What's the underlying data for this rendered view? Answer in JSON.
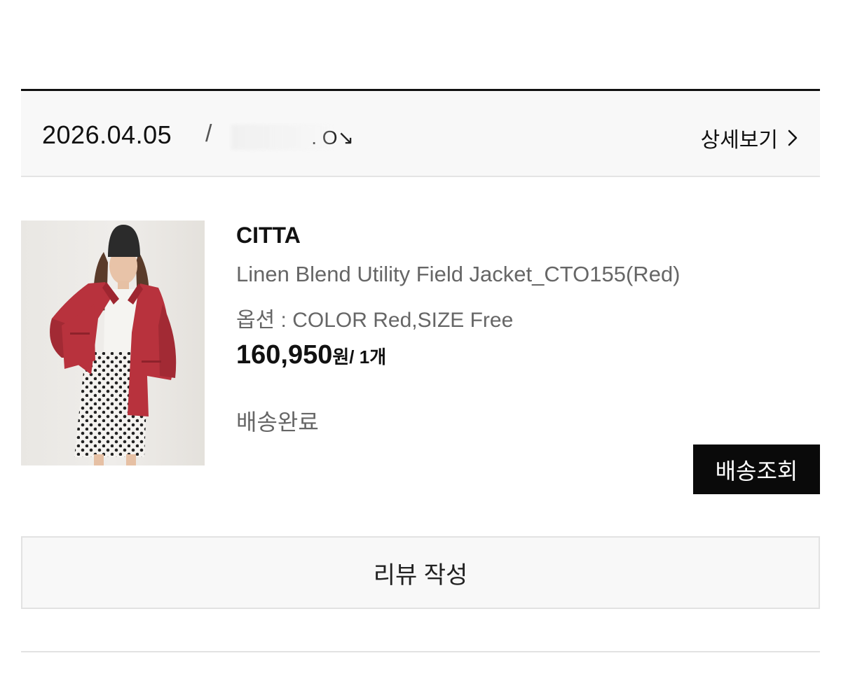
{
  "order": {
    "date": "2026.04.05",
    "separator": "/",
    "number_visible": ". O↘",
    "detail_label": "상세보기"
  },
  "product": {
    "brand": "CITTA",
    "name": "Linen Blend Utility Field Jacket_CTO155(Red)",
    "option": "옵션 : COLOR Red,SIZE Free",
    "price": "160,950",
    "currency": "원",
    "quantity": "/ 1개",
    "status": "배송완료",
    "image_icon": "product-photo"
  },
  "actions": {
    "track_label": "배송조회",
    "review_label": "리뷰 작성"
  },
  "colors": {
    "accent": "#0a0a0a",
    "jacket": "#b8323d",
    "header_bg": "#f8f8f8"
  }
}
